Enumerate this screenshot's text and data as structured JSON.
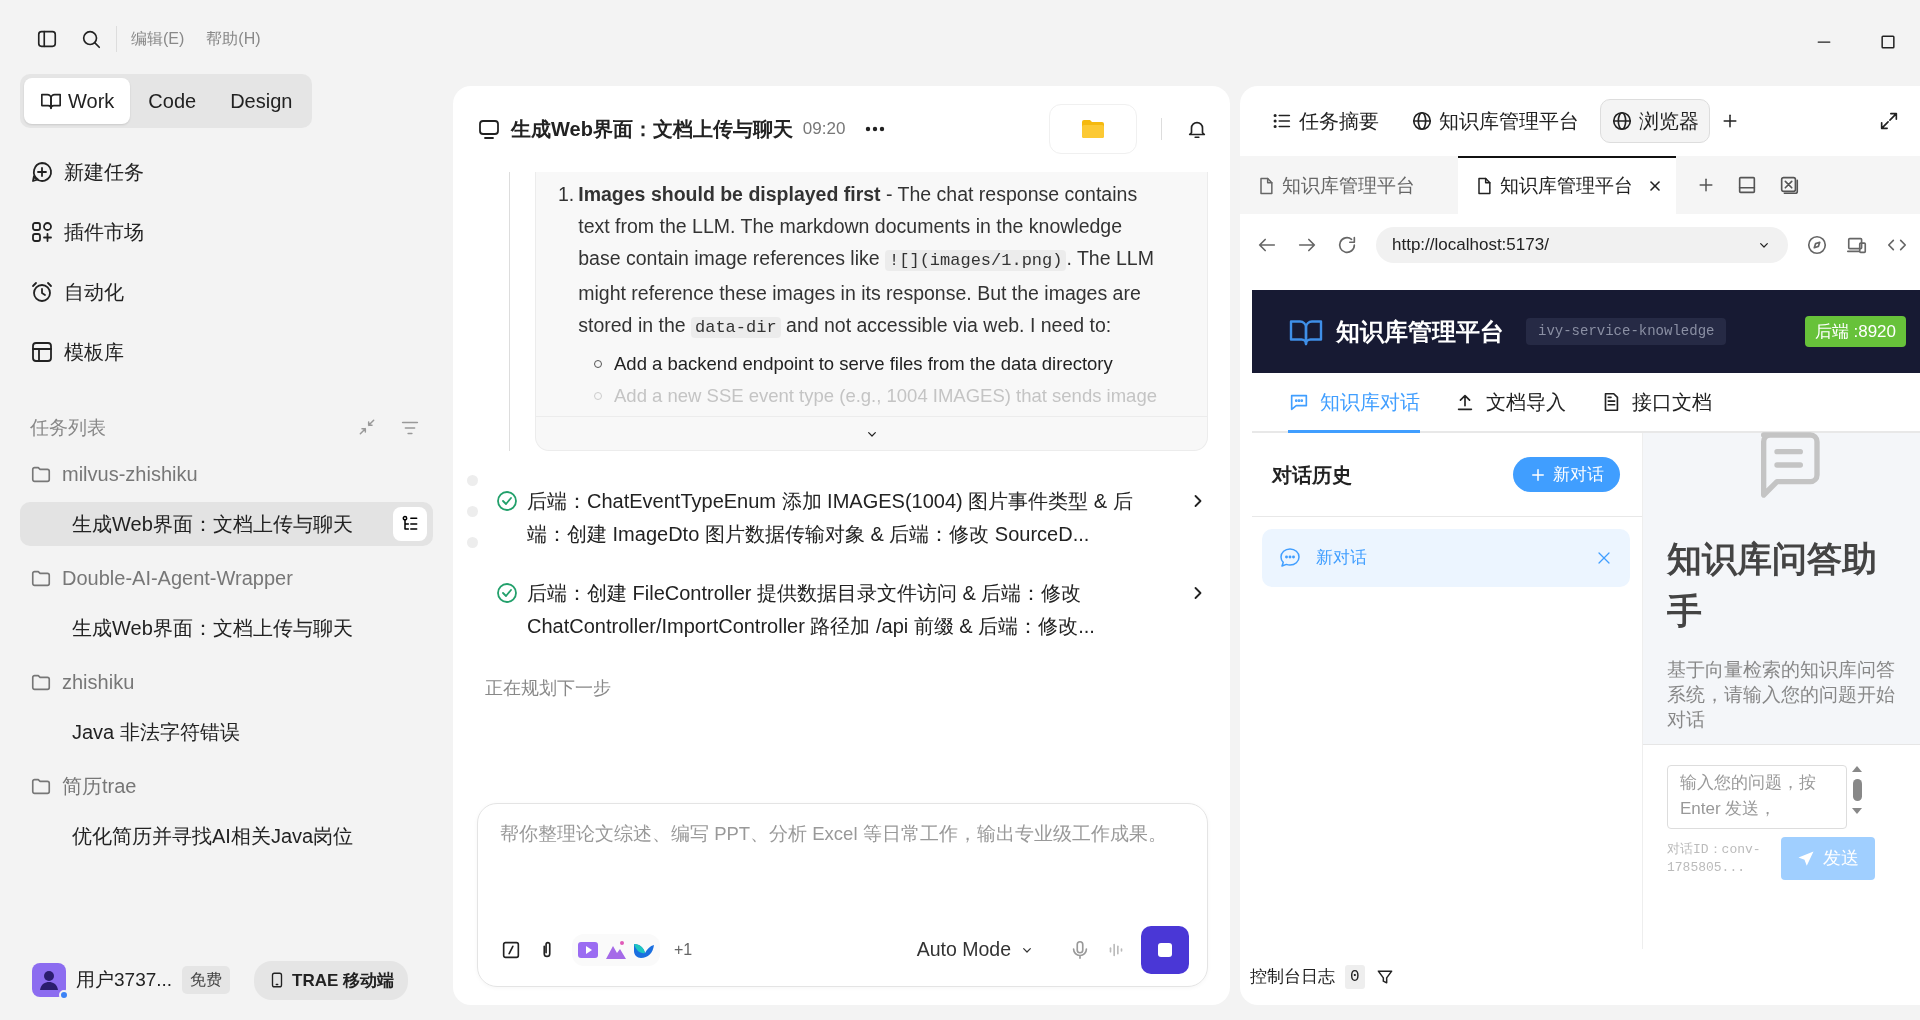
{
  "toolbar": {
    "menus": [
      "编辑(E)",
      "帮助(H)"
    ]
  },
  "modes": [
    {
      "label": "Work",
      "selected": true
    },
    {
      "label": "Code",
      "selected": false
    },
    {
      "label": "Design",
      "selected": false
    }
  ],
  "nav": [
    {
      "label": "新建任务"
    },
    {
      "label": "插件市场"
    },
    {
      "label": "自动化"
    },
    {
      "label": "模板库"
    }
  ],
  "task_list": {
    "title": "任务列表",
    "groups": [
      {
        "name": "milvus-zhishiku",
        "children": [
          {
            "label": "生成Web界面：文档上传与聊天",
            "selected": true
          }
        ]
      },
      {
        "name": "Double-AI-Agent-Wrapper",
        "children": [
          {
            "label": "生成Web界面：文档上传与聊天",
            "selected": false
          }
        ]
      },
      {
        "name": "zhishiku",
        "children": [
          {
            "label": "Java 非法字符错误",
            "selected": false
          }
        ]
      },
      {
        "name": "简历trae",
        "children": [
          {
            "label": "优化简历并寻找AI相关Java岗位",
            "selected": false
          }
        ]
      }
    ]
  },
  "user": {
    "name": "用户3737...",
    "plan": "免费",
    "mobile": "TRAE 移动端"
  },
  "chat": {
    "title": "生成Web界面：文档上传与聊天",
    "time": "09:20",
    "thought": {
      "number": "1.",
      "segments": [
        {
          "kind": "bold",
          "text": "Images should be displayed first"
        },
        {
          "kind": "plain",
          "text": " - The chat response contains text from the LLM. The markdown documents in the knowledge base contain image references like "
        },
        {
          "kind": "code",
          "text": "![](images/1.png)"
        },
        {
          "kind": "plain",
          "text": ". The LLM might reference these images in its response. But the images are stored in the "
        },
        {
          "kind": "code",
          "text": "data-dir"
        },
        {
          "kind": "plain",
          "text": " and not accessible via web. I need to:"
        }
      ],
      "bullets": [
        {
          "text": "Add a backend endpoint to serve files from the data directory",
          "faded": false
        },
        {
          "text": "Add a new SSE event type (e.g., 1004 IMAGES) that sends image",
          "faded": true
        }
      ]
    },
    "steps": [
      {
        "text": "后端：ChatEventTypeEnum 添加 IMAGES(1004) 图片事件类型 & 后端：创建 ImageDto 图片数据传输对象 & 后端：修改 SourceD...",
        "done": true
      },
      {
        "text": "后端：创建 FileController 提供数据目录文件访问 & 后端：修改 ChatController/ImportController 路径加 /api 前缀 & 后端：修改...",
        "done": true
      }
    ],
    "status": "正在规划下一步",
    "composer": {
      "placeholder": "帮你整理论文综述、编写 PPT、分析 Excel 等日常工作，输出专业级工作成果。",
      "extra_tools": "+1",
      "mode": "Auto Mode"
    }
  },
  "right": {
    "tabs": [
      {
        "kind": "list",
        "label": "任务摘要",
        "selected": false
      },
      {
        "kind": "globe",
        "label": "知识库管理平台",
        "selected": false
      },
      {
        "kind": "globe",
        "label": "浏览器",
        "selected": true
      }
    ],
    "browser": {
      "tabs": [
        {
          "label": "知识库管理平台",
          "selected": false
        },
        {
          "label": "知识库管理平台",
          "selected": true
        }
      ],
      "url": "http://localhost:5173/",
      "page": {
        "title": "知识库管理平台",
        "service": "ivy-service-knowledge",
        "backend": "后端 :8920",
        "nav": [
          {
            "kind": "chat",
            "label": "知识库对话",
            "selected": true
          },
          {
            "kind": "upload",
            "label": "文档导入",
            "selected": false
          },
          {
            "kind": "doc",
            "label": "接口文档",
            "selected": false
          }
        ],
        "history_title": "对话历史",
        "new_chat": "新对话",
        "conversations": [
          {
            "label": "新对话",
            "selected": true
          }
        ],
        "welcome_title": "知识库问答助手",
        "welcome_text": "基于向量检索的知识库问答系统，请输入您的问题开始对话",
        "input_placeholder": "输入您的问题，按 Enter 发送，",
        "conversation_id": "对话ID：conv-1785805...",
        "send": {
          "label": "发送",
          "disabled": true
        }
      }
    },
    "console": {
      "label": "控制台日志",
      "count": "0"
    }
  }
}
